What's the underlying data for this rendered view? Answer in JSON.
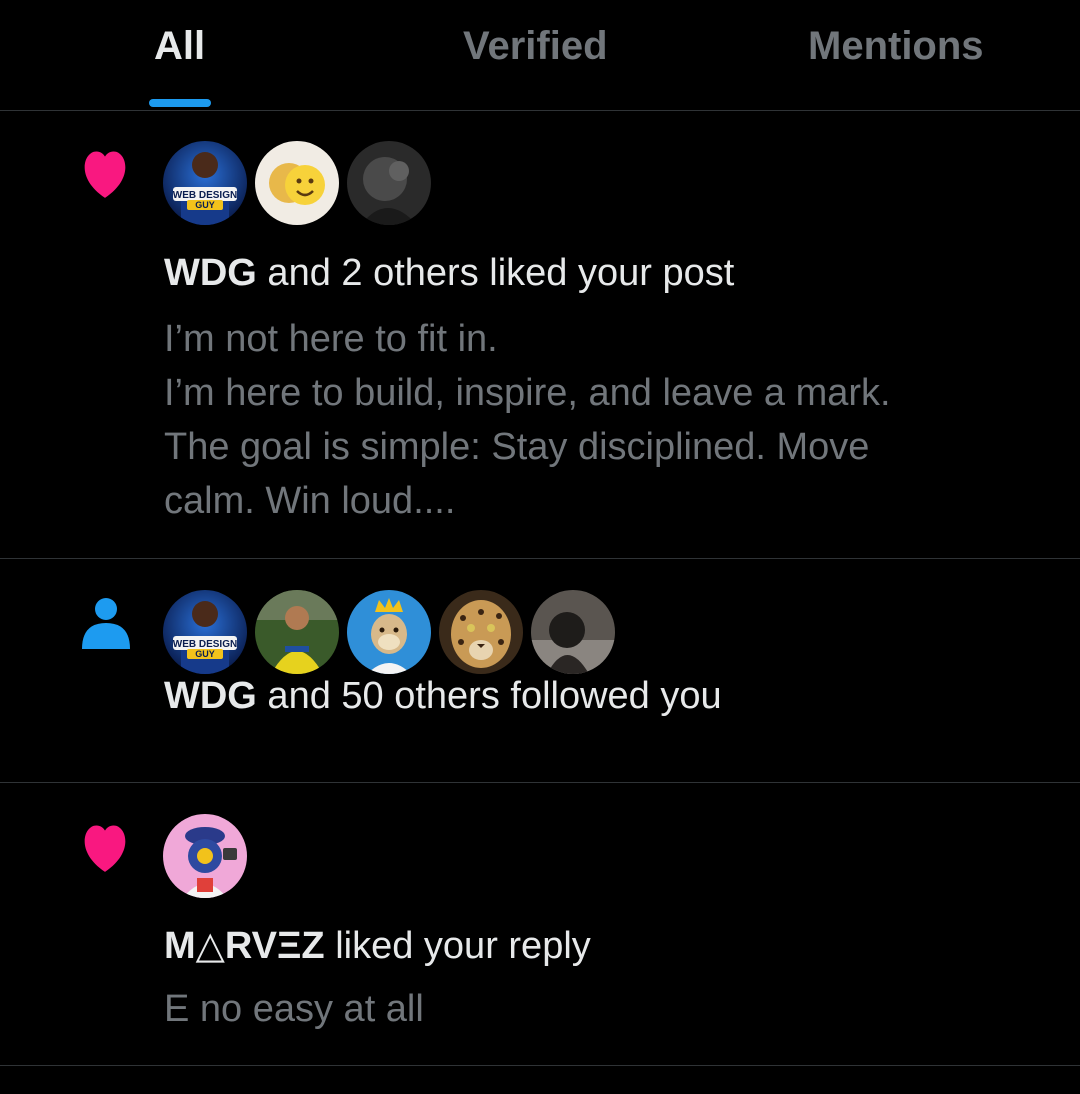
{
  "tabs": [
    {
      "label": "All",
      "active": true
    },
    {
      "label": "Verified",
      "active": false
    },
    {
      "label": "Mentions",
      "active": false
    }
  ],
  "colors": {
    "background": "#000000",
    "accent": "#1d9bf0",
    "like": "#f91880",
    "text_primary": "#e7e9ea",
    "text_secondary": "#71767b",
    "divider": "#2f3336"
  },
  "notifications": [
    {
      "type": "like",
      "icon": "heart-icon",
      "actor": "WDG",
      "action": " and 2 others liked your post",
      "avatars": [
        {
          "name": "web-design-guy-avatar",
          "badge_line1": "WEB DESIGN",
          "badge_line2": "GUY"
        },
        {
          "name": "emoji-avatar"
        },
        {
          "name": "dark-avatar"
        }
      ],
      "snippet": [
        "I’m not here to fit in.",
        "I’m here to build, inspire, and leave a mark.",
        "The goal is simple: Stay disciplined. Move",
        "calm. Win loud...."
      ]
    },
    {
      "type": "follow",
      "icon": "person-icon",
      "actor": "WDG",
      "action": " and 50 others followed you",
      "avatars": [
        {
          "name": "web-design-guy-avatar",
          "badge_line1": "WEB DESIGN",
          "badge_line2": "GUY"
        },
        {
          "name": "footballer-avatar"
        },
        {
          "name": "ape-king-avatar"
        },
        {
          "name": "leopard-avatar"
        },
        {
          "name": "grey-photo-avatar"
        }
      ]
    },
    {
      "type": "like",
      "icon": "heart-icon",
      "actor": "M△RVΞZ",
      "action": " liked your reply",
      "avatars": [
        {
          "name": "pink-character-avatar"
        }
      ],
      "snippet": [
        "E no easy at all"
      ]
    }
  ]
}
